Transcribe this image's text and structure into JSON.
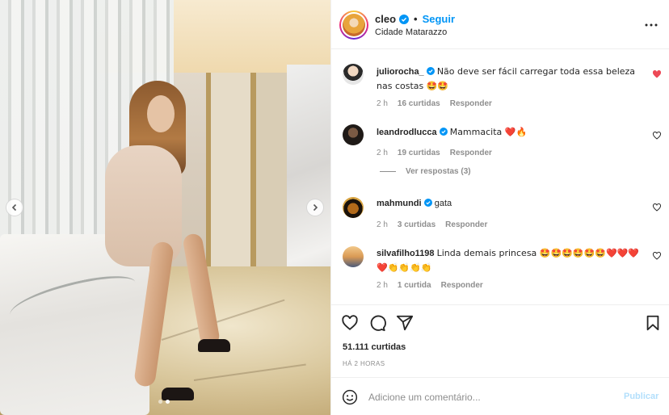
{
  "post": {
    "user": "cleo",
    "follow_label": "Seguir",
    "separator": "•",
    "location": "Cidade Matarazzo",
    "likes": "51.111 curtidas",
    "time": "HÁ 2 HORAS"
  },
  "comments": [
    {
      "user": "juliorocha_",
      "text": "Não deve ser fácil carregar toda essa beleza nas costas 🤩🤩",
      "age": "2 h",
      "likes": "16 curtidas",
      "reply": "Responder",
      "liked": true
    },
    {
      "user": "leandrodlucca",
      "text": "Mammacita ❤️🔥",
      "age": "2 h",
      "likes": "19 curtidas",
      "reply": "Responder",
      "liked": false,
      "view_replies": "Ver respostas (3)"
    },
    {
      "user": "mahmundi",
      "text": "gata",
      "age": "2 h",
      "likes": "3 curtidas",
      "reply": "Responder",
      "liked": false
    },
    {
      "user": "silvafilho1198",
      "text": "Linda demais princesa 🤩🤩🤩🤩🤩🤩❤️❤️❤️❤️👏👏👏👏",
      "age": "2 h",
      "likes": "1 curtida",
      "reply": "Responder",
      "liked": false
    }
  ],
  "composer": {
    "placeholder": "Adicione um comentário...",
    "publish_label": "Publicar"
  },
  "colors": {
    "accent": "#0095f6",
    "like_red": "#ed4956",
    "muted": "#8e8e8e"
  },
  "icons": [
    "verified-badge-icon",
    "more-options-icon",
    "heart-icon",
    "comment-icon",
    "share-icon",
    "save-icon",
    "emoji-icon",
    "chevron-left-icon",
    "chevron-right-icon"
  ]
}
